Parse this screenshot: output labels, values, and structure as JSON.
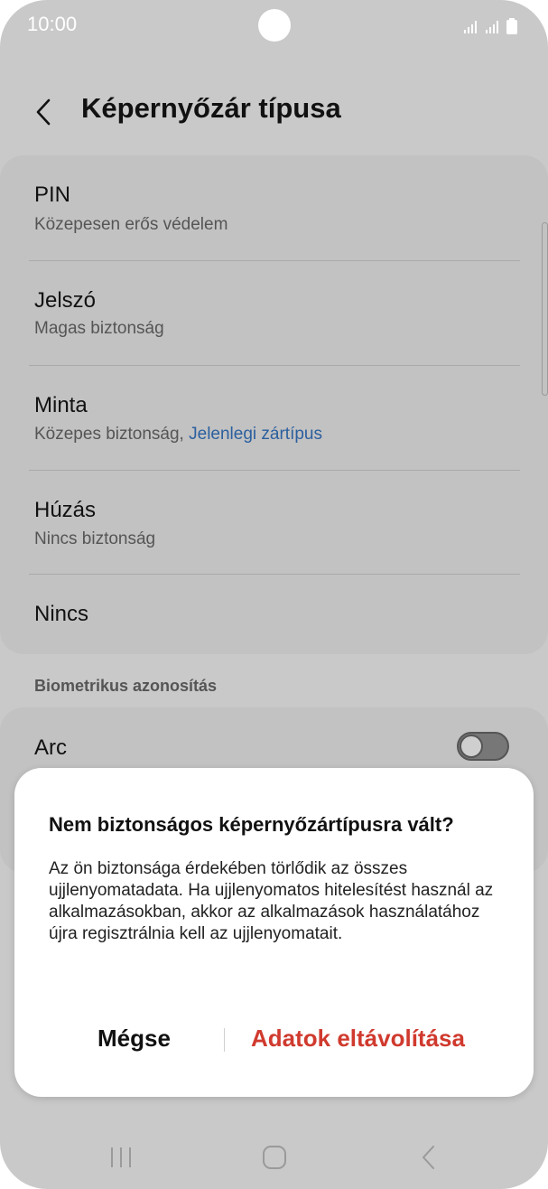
{
  "status_bar": {
    "time": "10:00"
  },
  "header": {
    "title": "Képernyőzár típusa"
  },
  "lock_types": [
    {
      "title": "PIN",
      "subtitle": "Közepesen erős védelem"
    },
    {
      "title": "Jelszó",
      "subtitle": "Magas biztonság"
    },
    {
      "title": "Minta",
      "subtitle": "Közepes biztonság, ",
      "current": "Jelenlegi zártípus"
    },
    {
      "title": "Húzás",
      "subtitle": "Nincs biztonság"
    },
    {
      "title": "Nincs"
    }
  ],
  "biometrics": {
    "section_label": "Biometrikus azonosítás",
    "face_label": "Arc",
    "face_toggle_on": false
  },
  "dialog": {
    "title": "Nem biztonságos képernyőzártípusra vált?",
    "body": "Az ön biztonsága érdekében törlődik az összes ujjlenyomatadata. Ha ujjlenyomatos hitelesítést használ az alkalmazásokban, akkor az alkalmazások használatához újra regisztrálnia kell az ujjlenyomatait.",
    "cancel_label": "Mégse",
    "remove_label": "Adatok eltávolítása"
  },
  "colors": {
    "accent_link": "#2b5f9e",
    "destructive": "#d03a2e",
    "dimmed_background": "#c9c9c9"
  },
  "icons": {
    "back": "chevron-left-icon",
    "recents": "recents-icon",
    "home": "home-icon",
    "nav_back": "nav-back-icon"
  }
}
